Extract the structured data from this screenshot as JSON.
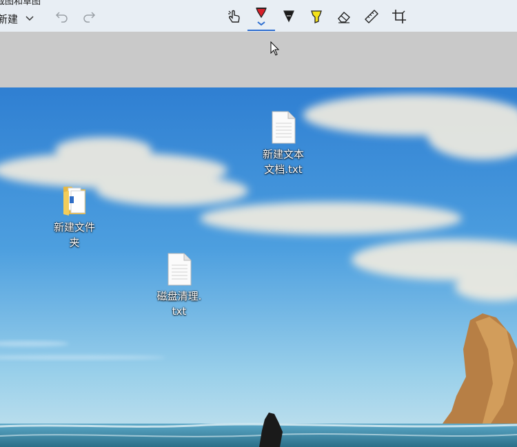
{
  "toolbar": {
    "title_fragment": "截图和草图",
    "new_label": "新建",
    "tools": [
      "touch-writing",
      "ballpoint-pen",
      "pencil",
      "highlighter",
      "eraser",
      "ruler",
      "crop"
    ],
    "active_tool": "ballpoint-pen",
    "colors": {
      "toolbar_bg": "#e8eef4",
      "active": "#2b6ccf",
      "pen_red": "#d8202a",
      "highlighter": "#f5e21a"
    }
  },
  "desktop": {
    "icons": [
      {
        "label_line1": "新建文本",
        "label_line2": "文档.txt",
        "kind": "text-file"
      },
      {
        "label_line1": "新建文件",
        "label_line2": "夹",
        "kind": "folder"
      },
      {
        "label_line1": "磁盘清理.",
        "label_line2": "txt",
        "kind": "text-file"
      }
    ]
  }
}
